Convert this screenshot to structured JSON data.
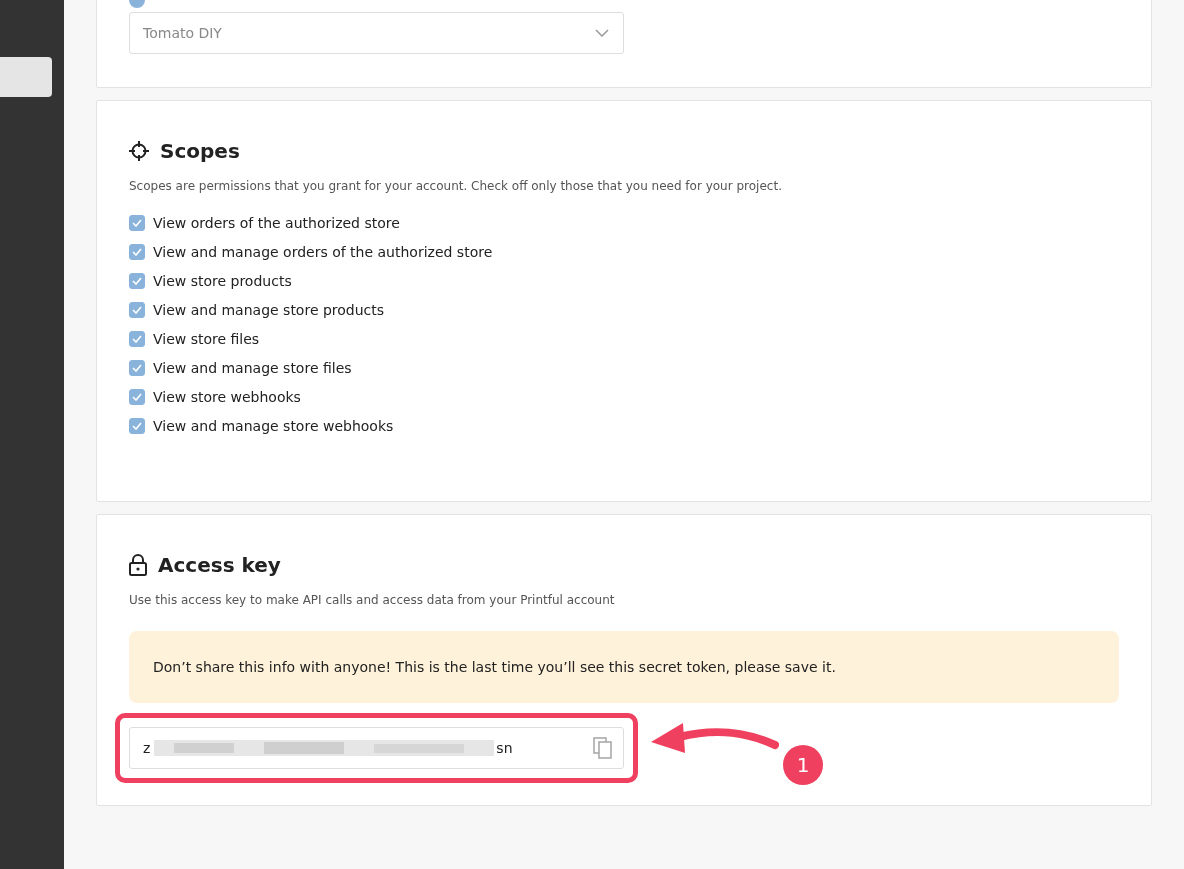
{
  "store_option": {
    "selected": true
  },
  "store_select": {
    "value": "Tomato DIY"
  },
  "scopes": {
    "title": "Scopes",
    "description": "Scopes are permissions that you grant for your account. Check off only those that you need for your project.",
    "items": [
      {
        "label": "View orders of the authorized store",
        "checked": true
      },
      {
        "label": "View and manage orders of the authorized store",
        "checked": true
      },
      {
        "label": "View store products",
        "checked": true
      },
      {
        "label": "View and manage store products",
        "checked": true
      },
      {
        "label": "View store files",
        "checked": true
      },
      {
        "label": "View and manage store files",
        "checked": true
      },
      {
        "label": "View store webhooks",
        "checked": true
      },
      {
        "label": "View and manage store webhooks",
        "checked": true
      }
    ]
  },
  "access_key": {
    "title": "Access key",
    "description": "Use this access key to make API calls and access data from your Printful account",
    "warning": "Don’t share this info with anyone! This is the last time you’ll see this secret token, please save it.",
    "token_start": "z",
    "token_end": "sn"
  },
  "annotation": {
    "badge": "1"
  }
}
